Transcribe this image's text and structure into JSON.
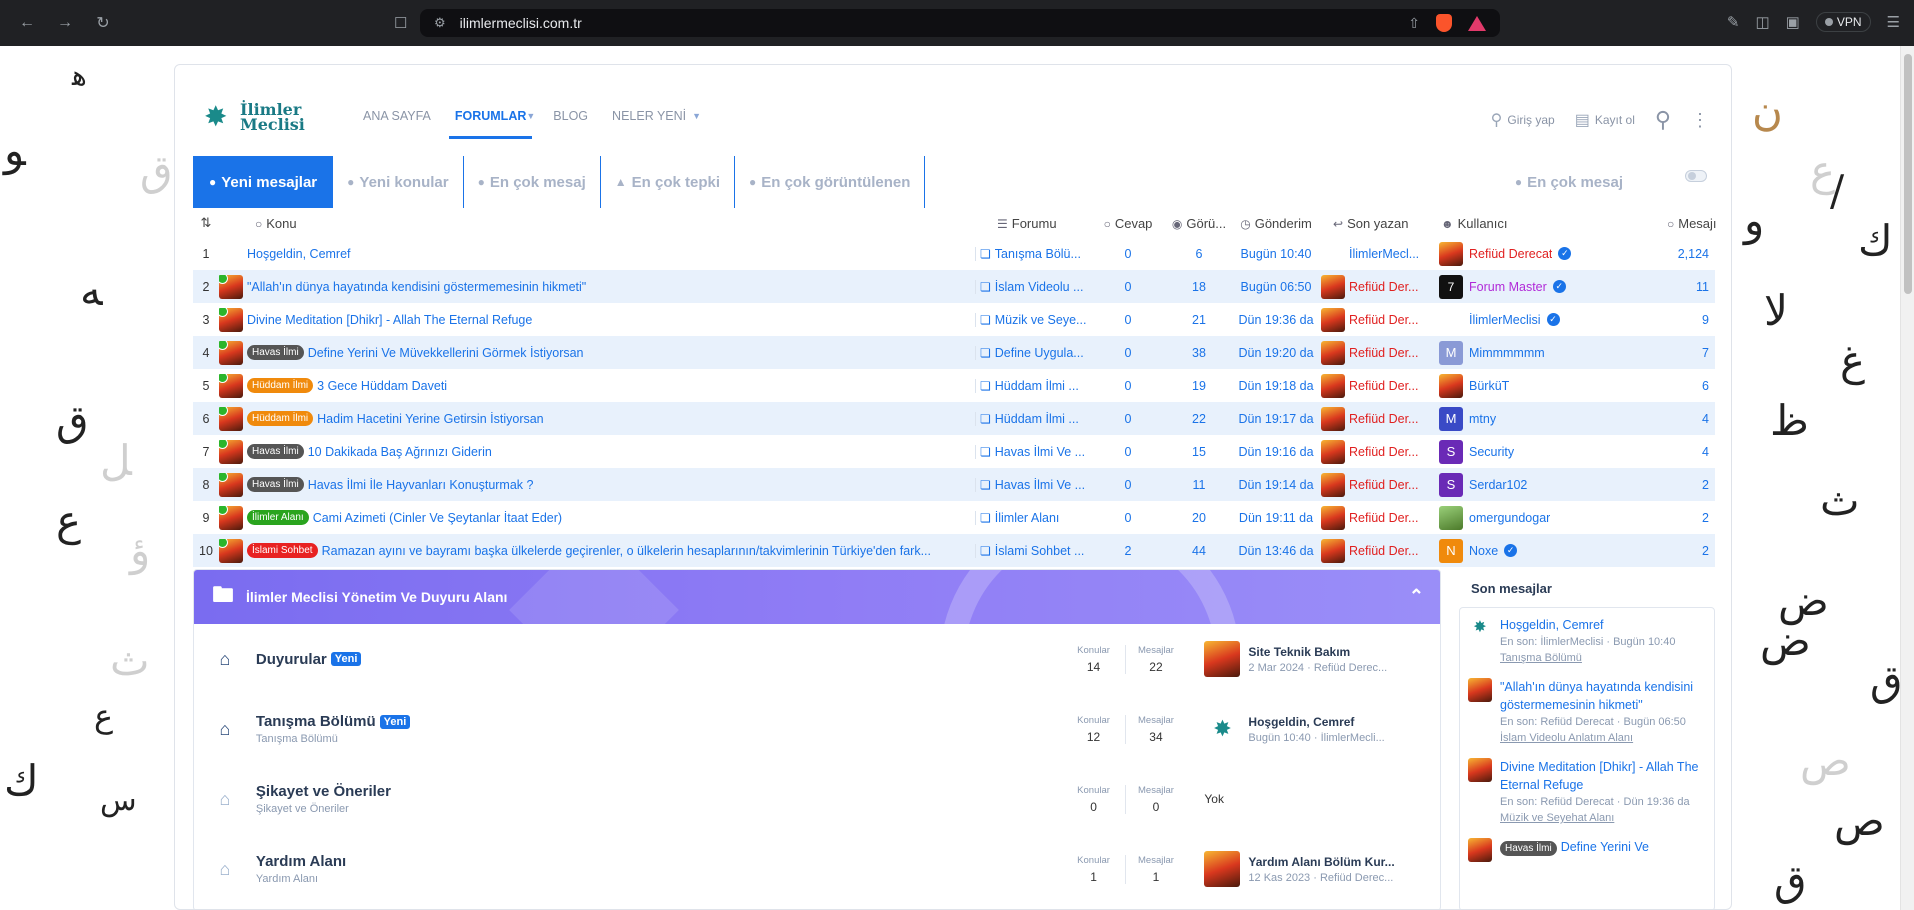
{
  "browser": {
    "url": "ilimlermeclisi.com.tr",
    "vpn_label": "VPN"
  },
  "site": {
    "logo_line1": "İlimler",
    "logo_line2": "Meclisi",
    "nav": [
      {
        "label": "ANA SAYFA"
      },
      {
        "label": "FORUMLAR"
      },
      {
        "label": "BLOG"
      },
      {
        "label": "NELER YENİ"
      }
    ],
    "login": "Giriş yap",
    "register": "Kayıt ol"
  },
  "tabs": [
    {
      "label": "Yeni mesajlar"
    },
    {
      "label": "Yeni konular"
    },
    {
      "label": "En çok mesaj"
    },
    {
      "label": "En çok tepki"
    },
    {
      "label": "En çok görüntülenen"
    }
  ],
  "tab_right": "En çok mesaj",
  "table": {
    "headers": {
      "topic": "Konu",
      "forum": "Forumu",
      "replies": "Cevap",
      "views": "Görü...",
      "date": "Gönderim",
      "last": "Son yazan",
      "user": "Kullanıcı",
      "messages": "Mesajı"
    },
    "rows": [
      {
        "n": "1",
        "badge": "",
        "badge_type": "",
        "title": "Hoşgeldin, Cemref",
        "forum": "Tanışma Bölü...",
        "replies": "0",
        "views": "6",
        "date": "Bugün 10:40",
        "last": "İlimlerMecl...",
        "last_type": "logo",
        "user": "Refiüd Derecat",
        "user_color": "red",
        "user_av": "fire",
        "verified": true,
        "msgs": "2,124"
      },
      {
        "n": "2",
        "badge": "",
        "badge_type": "",
        "title": "\"Allah'ın dünya hayatında kendisini göstermemesinin hikmeti\"",
        "forum": "İslam Videolu ...",
        "replies": "0",
        "views": "18",
        "date": "Bugün 06:50",
        "last": "Refiüd Der...",
        "last_type": "fire",
        "user": "Forum Master",
        "user_color": "purple",
        "user_av": "black",
        "verified": true,
        "msgs": "11"
      },
      {
        "n": "3",
        "badge": "",
        "badge_type": "",
        "title": "Divine Meditation [Dhikr] - Allah The Eternal Refuge",
        "forum": "Müzik ve Seye...",
        "replies": "0",
        "views": "21",
        "date": "Dün 19:36 da",
        "last": "Refiüd Der...",
        "last_type": "fire",
        "user": "İlimlerMeclisi",
        "user_color": "blue",
        "user_av": "logo",
        "verified": true,
        "msgs": "9"
      },
      {
        "n": "4",
        "badge": "Havas İlmi",
        "badge_type": "b-havas",
        "title": "Define Yerini Ve Müvekkellerini Görmek İstiyorsan",
        "forum": "Define Uygula...",
        "replies": "0",
        "views": "38",
        "date": "Dün 19:20 da",
        "last": "Refiüd Der...",
        "last_type": "fire",
        "user": "Mimmmmmm",
        "user_color": "blue",
        "user_av": "M1",
        "verified": false,
        "msgs": "7"
      },
      {
        "n": "5",
        "badge": "Hüddam İlmi",
        "badge_type": "b-huddam",
        "title": "3 Gece Hüddam Daveti",
        "forum": "Hüddam İlmi ...",
        "replies": "0",
        "views": "19",
        "date": "Dün 19:18 da",
        "last": "Refiüd Der...",
        "last_type": "fire",
        "user": "BürküT",
        "user_color": "blue",
        "user_av": "fire",
        "verified": false,
        "msgs": "6"
      },
      {
        "n": "6",
        "badge": "Hüddam İlmi",
        "badge_type": "b-huddam",
        "title": "Hadim Hacetini Yerine Getirsin İstiyorsan",
        "forum": "Hüddam İlmi ...",
        "replies": "0",
        "views": "22",
        "date": "Dün 19:17 da",
        "last": "Refiüd Der...",
        "last_type": "fire",
        "user": "mtny",
        "user_color": "blue",
        "user_av": "M2",
        "verified": false,
        "msgs": "4"
      },
      {
        "n": "7",
        "badge": "Havas İlmi",
        "badge_type": "b-havas",
        "title": "10 Dakikada Baş Ağrınızı Giderin",
        "forum": "Havas İlmi Ve ...",
        "replies": "0",
        "views": "15",
        "date": "Dün 19:16 da",
        "last": "Refiüd Der...",
        "last_type": "fire",
        "user": "Security",
        "user_color": "blue",
        "user_av": "S",
        "verified": false,
        "msgs": "4"
      },
      {
        "n": "8",
        "badge": "Havas İlmi",
        "badge_type": "b-havas",
        "title": "Havas İlmi İle Hayvanları Konuşturmak ?",
        "forum": "Havas İlmi Ve ...",
        "replies": "0",
        "views": "11",
        "date": "Dün 19:14 da",
        "last": "Refiüd Der...",
        "last_type": "fire",
        "user": "Serdar102",
        "user_color": "blue",
        "user_av": "S",
        "verified": false,
        "msgs": "2"
      },
      {
        "n": "9",
        "badge": "İlimler Alanı",
        "badge_type": "b-ilimler",
        "title": "Cami Azimeti (Cinler Ve Şeytanlar İtaat Eder)",
        "forum": "İlimler Alanı",
        "replies": "0",
        "views": "20",
        "date": "Dün 19:11 da",
        "last": "Refiüd Der...",
        "last_type": "fire",
        "user": "omergundogar",
        "user_color": "blue",
        "user_av": "green",
        "verified": false,
        "msgs": "2"
      },
      {
        "n": "10",
        "badge": "İslami Sohbet",
        "badge_type": "b-islami",
        "title": "Ramazan ayını ve bayramı başka ülkelerde geçirenler, o ülkelerin hesaplarının/takvimlerinin Türkiye'den fark...",
        "forum": "İslami Sohbet ...",
        "replies": "2",
        "views": "44",
        "date": "Dün 13:46 da",
        "last": "Refiüd Der...",
        "last_type": "fire",
        "user": "Noxe",
        "user_color": "blue",
        "user_av": "N",
        "verified": true,
        "msgs": "2"
      }
    ]
  },
  "category": {
    "title": "İlimler Meclisi Yönetim Ve Duyuru Alanı",
    "labels": {
      "topics": "Konular",
      "messages": "Mesajlar",
      "none": "Yok",
      "new": "Yeni"
    },
    "nodes": [
      {
        "title": "Duyurular",
        "sub": "",
        "is_new": true,
        "topics": "14",
        "messages": "22",
        "last_title": "Site Teknik Bakım",
        "last_meta": "2 Mar 2024 · Refiüd Derec...",
        "last_av": "fire"
      },
      {
        "title": "Tanışma Bölümü",
        "sub": "Tanışma Bölümü",
        "is_new": true,
        "topics": "12",
        "messages": "34",
        "last_title": "Hoşgeldin, Cemref",
        "last_meta": "Bugün 10:40 · İlimlerMecli...",
        "last_av": "logo"
      },
      {
        "title": "Şikayet ve Öneriler",
        "sub": "Şikayet ve Öneriler",
        "is_new": false,
        "topics": "0",
        "messages": "0",
        "last_title": "",
        "last_meta": "",
        "last_av": "none"
      },
      {
        "title": "Yardım Alanı",
        "sub": "Yardım Alanı",
        "is_new": false,
        "topics": "1",
        "messages": "1",
        "last_title": "Yardım Alanı Bölüm Kur...",
        "last_meta": "12 Kas 2023 · Refiüd Derec...",
        "last_av": "fire"
      }
    ]
  },
  "sidebar": {
    "title": "Son mesajlar",
    "items": [
      {
        "title": "Hoşgeldin, Cemref",
        "meta": "En son: İlimlerMeclisi · Bugün 10:40",
        "forum": "Tanışma Bölümü",
        "av": "logo",
        "badge": ""
      },
      {
        "title": "\"Allah'ın dünya hayatında kendisini göstermemesinin hikmeti\"",
        "meta": "En son: Refiüd Derecat · Bugün 06:50",
        "forum": "İslam Videolu Anlatım Alanı",
        "av": "fire",
        "badge": ""
      },
      {
        "title": "Divine Meditation [Dhikr] - Allah The Eternal Refuge",
        "meta": "En son: Refiüd Derecat · Dün 19:36 da",
        "forum": "Müzik ve Seyehat Alanı",
        "av": "fire",
        "badge": ""
      },
      {
        "title": "Define Yerini Ve",
        "meta": "",
        "forum": "",
        "av": "fire",
        "badge": "Havas İlmi"
      }
    ]
  },
  "colors": {
    "accent": "#1a73e8",
    "last_poster": "#e02020",
    "alt_row": "#e8f1fc"
  }
}
